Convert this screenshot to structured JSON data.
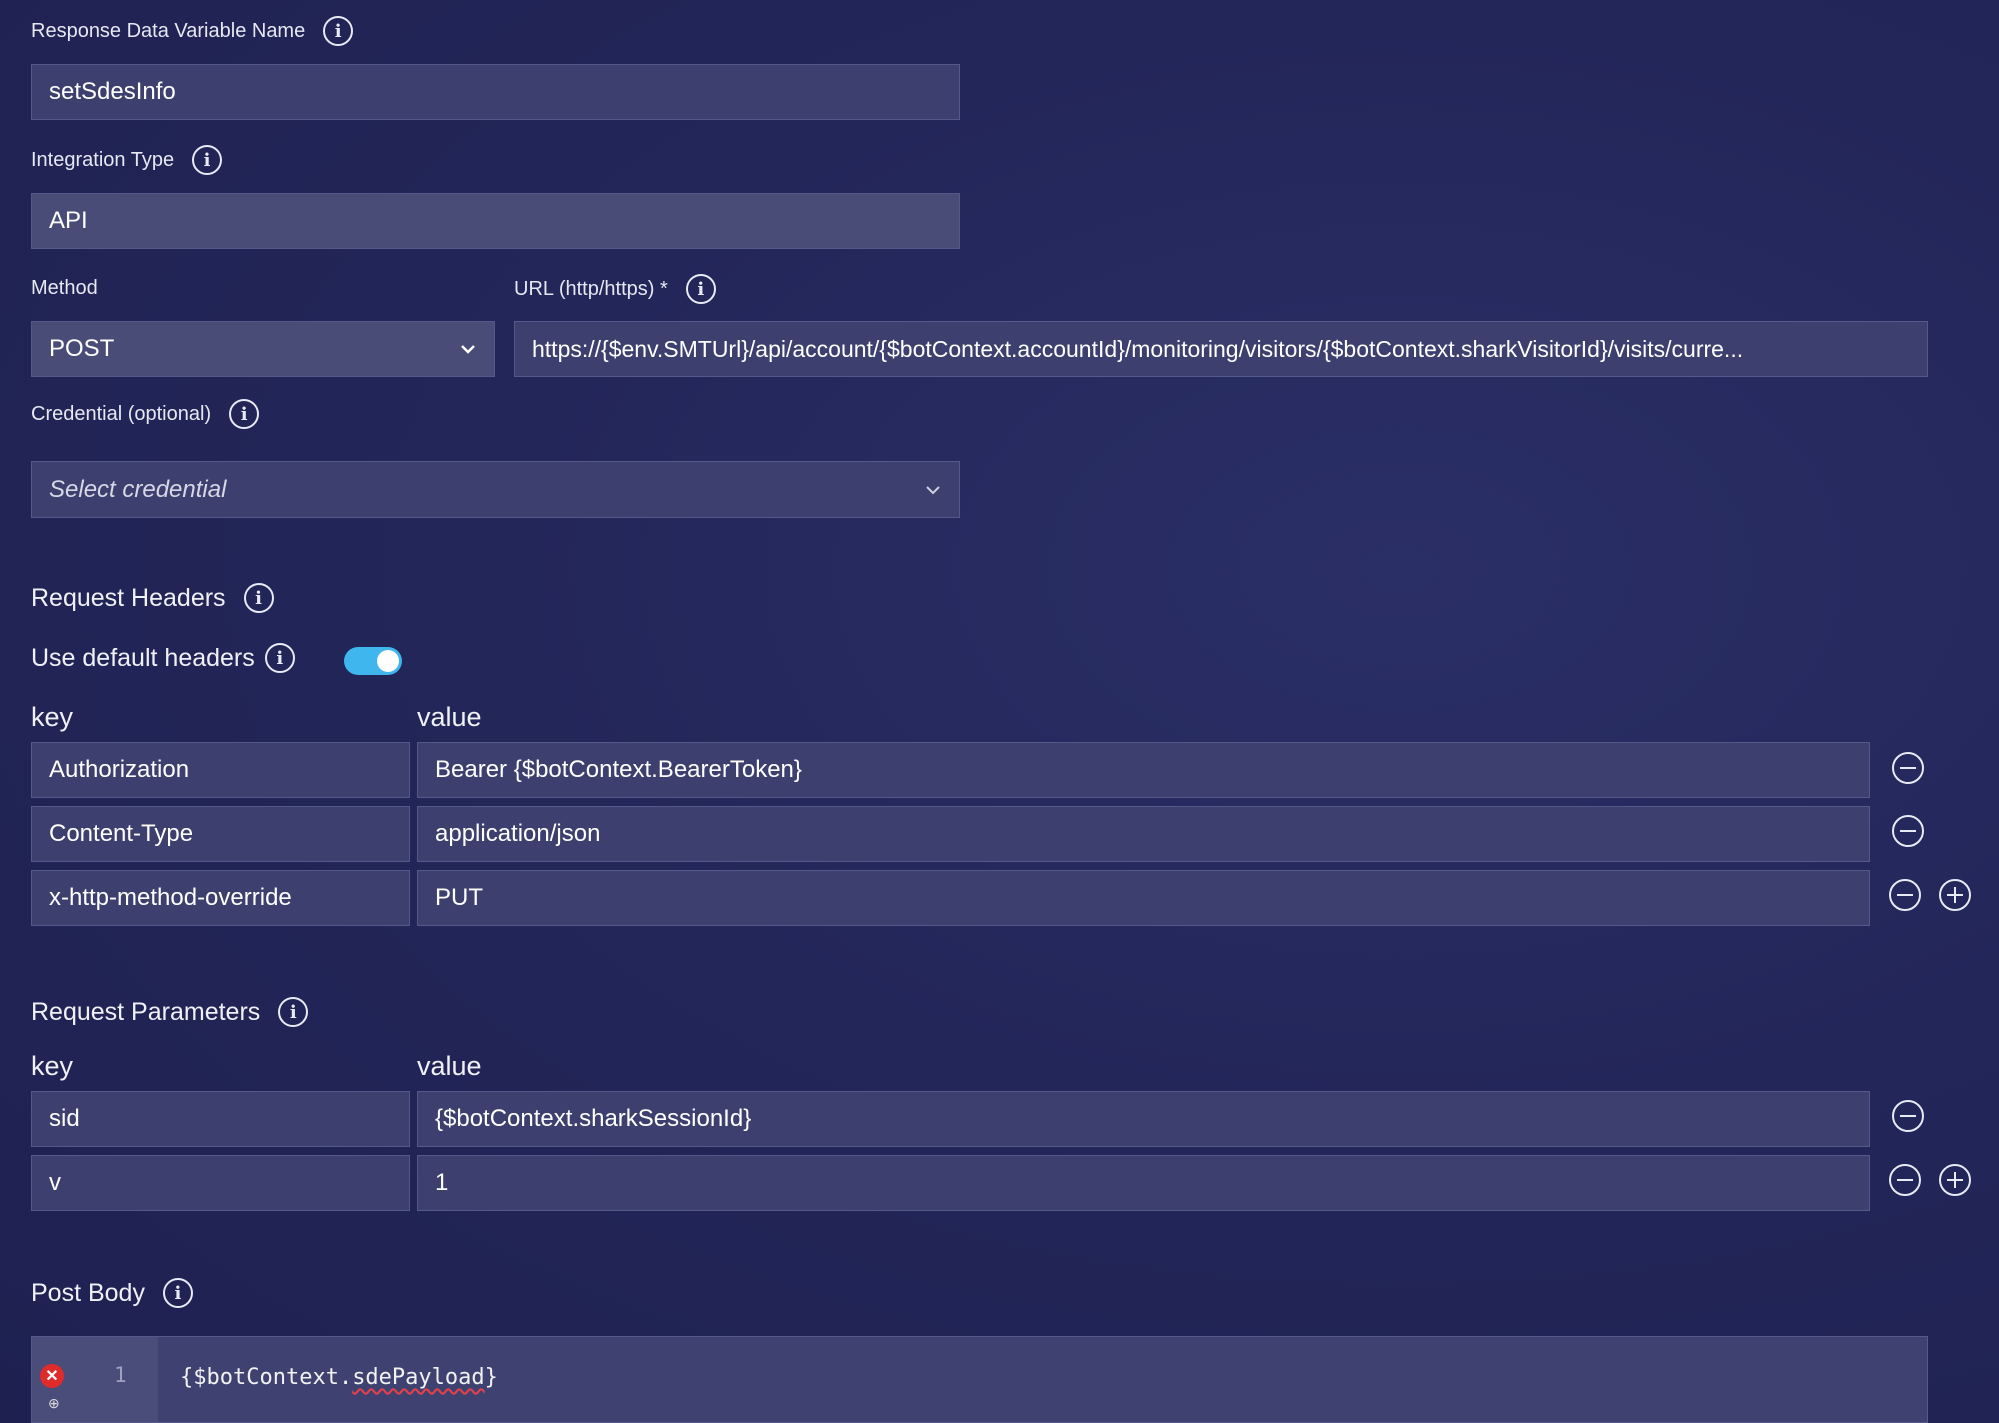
{
  "response_var": {
    "label": "Response Data Variable Name",
    "value": "setSdesInfo"
  },
  "integration_type": {
    "label": "Integration Type",
    "value": "API"
  },
  "method": {
    "label": "Method",
    "value": "POST"
  },
  "url": {
    "label": "URL (http/https) *",
    "value": "https://{$env.SMTUrl}/api/account/{$botContext.accountId}/monitoring/visitors/{$botContext.sharkVisitorId}/visits/curre..."
  },
  "credential": {
    "label": "Credential (optional)",
    "placeholder": "Select credential"
  },
  "request_headers": {
    "title": "Request Headers",
    "default_headers_label": "Use default headers",
    "default_headers_on": true,
    "key_header": "key",
    "value_header": "value",
    "rows": [
      {
        "key": "Authorization",
        "value": "Bearer {$botContext.BearerToken}"
      },
      {
        "key": "Content-Type",
        "value": "application/json"
      },
      {
        "key": "x-http-method-override",
        "value": "PUT"
      }
    ]
  },
  "request_parameters": {
    "title": "Request Parameters",
    "key_header": "key",
    "value_header": "value",
    "rows": [
      {
        "key": "sid",
        "value": "{$botContext.sharkSessionId}"
      },
      {
        "key": "v",
        "value": "1"
      }
    ]
  },
  "post_body": {
    "title": "Post Body",
    "line_number": "1",
    "code_prefix": "{$botContext.",
    "code_flagged": "sdePayload",
    "code_suffix": "}"
  },
  "colors": {
    "toggle_on": "#3fb6ee",
    "error": "#e02b2b",
    "field_bg": "#3d3f6e"
  }
}
